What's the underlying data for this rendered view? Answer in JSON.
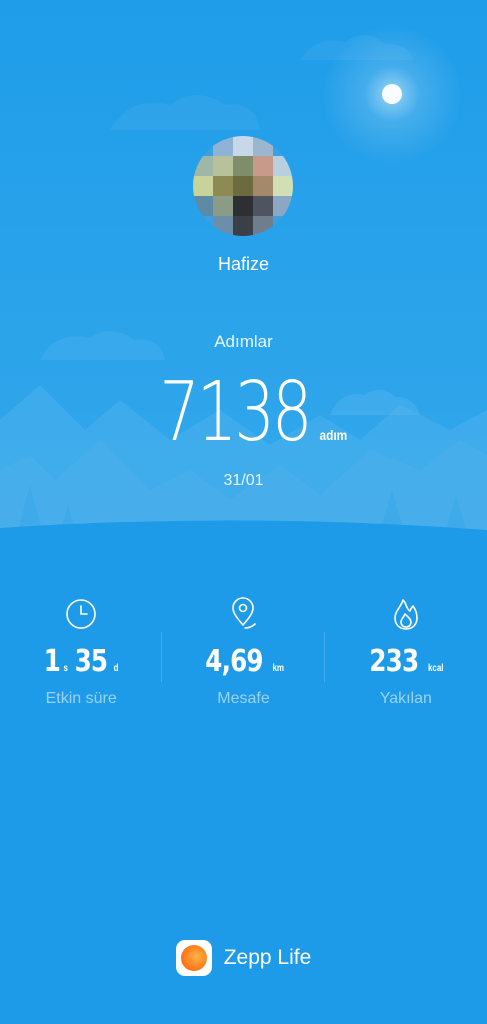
{
  "colors": {
    "background": "#1e9be8",
    "text": "#ffffff",
    "brand_orange": "#ff7a1a"
  },
  "profile": {
    "name": "Hafize",
    "avatar_icon": "blurred-profile-photo"
  },
  "steps": {
    "label": "Adımlar",
    "value": "7138",
    "unit": "adım",
    "date": "31/01"
  },
  "stats": [
    {
      "icon": "clock-icon",
      "hours": "1",
      "hours_unit": "s",
      "minutes": "35",
      "minutes_unit": "d",
      "label": "Etkin süre"
    },
    {
      "icon": "location-pin-icon",
      "value": "4,69",
      "unit": "km",
      "label": "Mesafe"
    },
    {
      "icon": "flame-icon",
      "value": "233",
      "unit": "kcal",
      "label": "Yakılan"
    }
  ],
  "brand": {
    "name": "Zepp Life",
    "logo_icon": "zepp-life-logo"
  }
}
